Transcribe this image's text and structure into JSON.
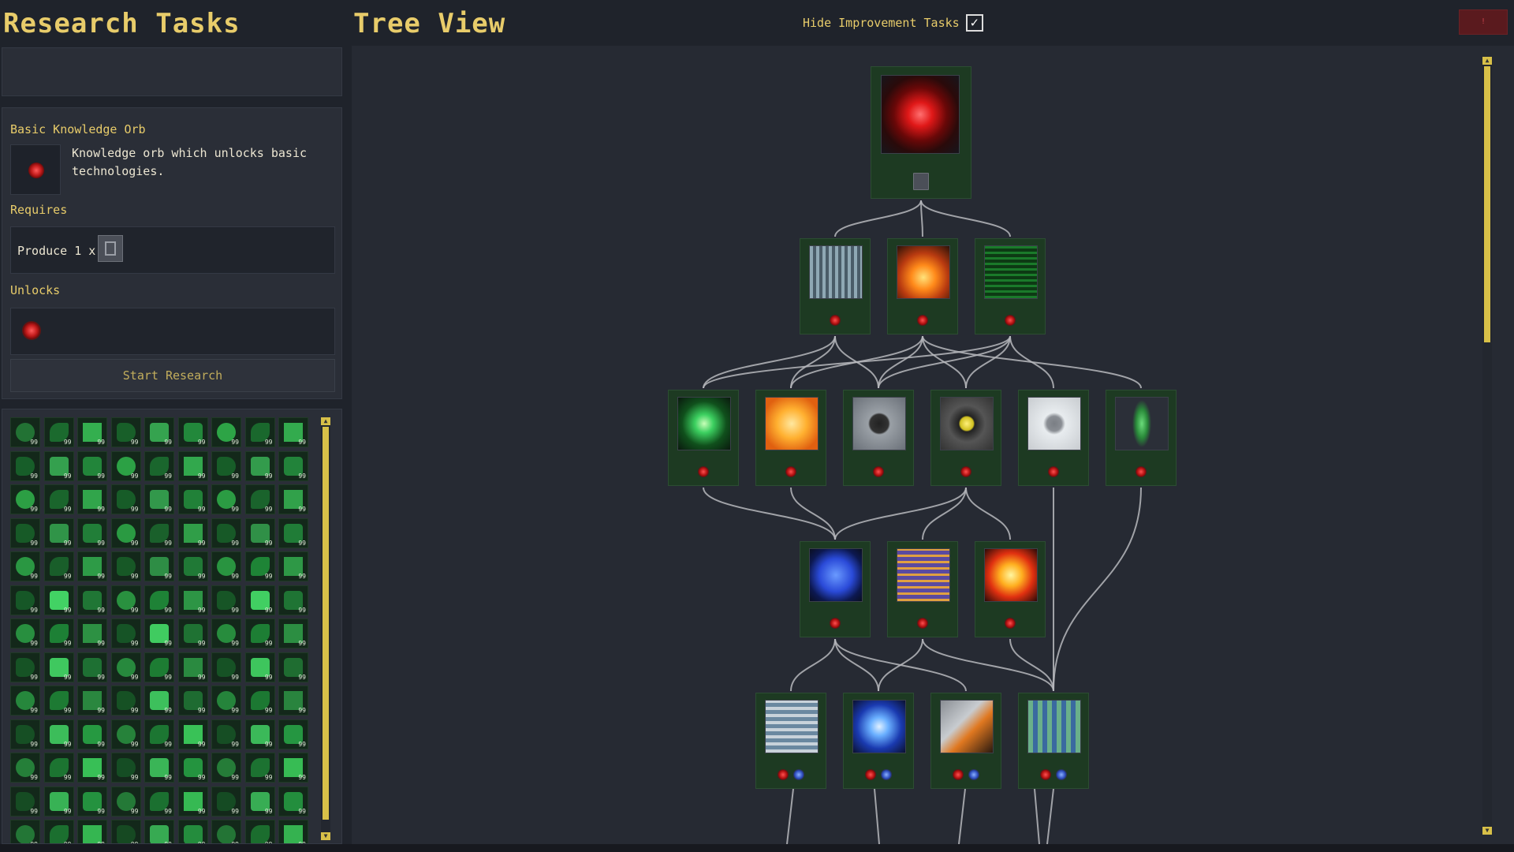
{
  "header": {
    "left_title": "Research Tasks",
    "right_title": "Tree View",
    "hide_label": "Hide Improvement Tasks",
    "hide_checked": "✓",
    "close_label": "!"
  },
  "detail": {
    "name": "Basic Knowledge Orb",
    "description": "Knowledge orb which unlocks basic technologies.",
    "requires_label": "Requires",
    "requires_text": "Produce 1 x",
    "unlocks_label": "Unlocks",
    "start_label": "Start Research"
  },
  "grid": {
    "count_label": "99",
    "rows": 13,
    "cols": 9
  },
  "colors": {
    "accent": "#e8cc6a",
    "scroll": "#d8c048",
    "node_bg": "#1d3a22",
    "panel": "#2a2e37",
    "link": "#b7b9bd"
  },
  "tree": {
    "nodes": [
      {
        "id": "n0",
        "name": "basic-knowledge-orb",
        "kind": "red-orb",
        "icons": [
          "chip"
        ]
      },
      {
        "id": "n1",
        "name": "data-server",
        "kind": "server",
        "icons": [
          "red"
        ]
      },
      {
        "id": "n2",
        "name": "smelting",
        "kind": "fire",
        "icons": [
          "red"
        ]
      },
      {
        "id": "n3",
        "name": "circuit-board",
        "kind": "circuit",
        "icons": [
          "red"
        ]
      },
      {
        "id": "n4",
        "name": "green-crystal",
        "kind": "green-star",
        "icons": [
          "red"
        ]
      },
      {
        "id": "n5",
        "name": "orange-processor",
        "kind": "orange-chip",
        "icons": [
          "red"
        ]
      },
      {
        "id": "n6",
        "name": "grey-module",
        "kind": "grey-box",
        "icons": [
          "red"
        ]
      },
      {
        "id": "n7",
        "name": "yellow-core",
        "kind": "yellow-core",
        "icons": [
          "red"
        ]
      },
      {
        "id": "n8",
        "name": "white-crate",
        "kind": "white-crate",
        "icons": [
          "red"
        ]
      },
      {
        "id": "n9",
        "name": "green-capsule",
        "kind": "capsule",
        "icons": [
          "red"
        ]
      },
      {
        "id": "n10",
        "name": "blue-sphere",
        "kind": "blue-sphere",
        "icons": [
          "red"
        ]
      },
      {
        "id": "n11",
        "name": "purple-machine",
        "kind": "purple-machine",
        "icons": [
          "red"
        ]
      },
      {
        "id": "n12",
        "name": "sun-core",
        "kind": "sun",
        "icons": [
          "red"
        ]
      },
      {
        "id": "n13",
        "name": "cable-rack",
        "kind": "rack",
        "icons": [
          "red",
          "blue"
        ]
      },
      {
        "id": "n14",
        "name": "blue-star",
        "kind": "blue-star",
        "icons": [
          "red",
          "blue"
        ]
      },
      {
        "id": "n15",
        "name": "pipe-block",
        "kind": "pipe",
        "icons": [
          "red",
          "blue"
        ]
      },
      {
        "id": "n16",
        "name": "robot-pod",
        "kind": "pod",
        "icons": [
          "red",
          "blue"
        ]
      }
    ]
  }
}
